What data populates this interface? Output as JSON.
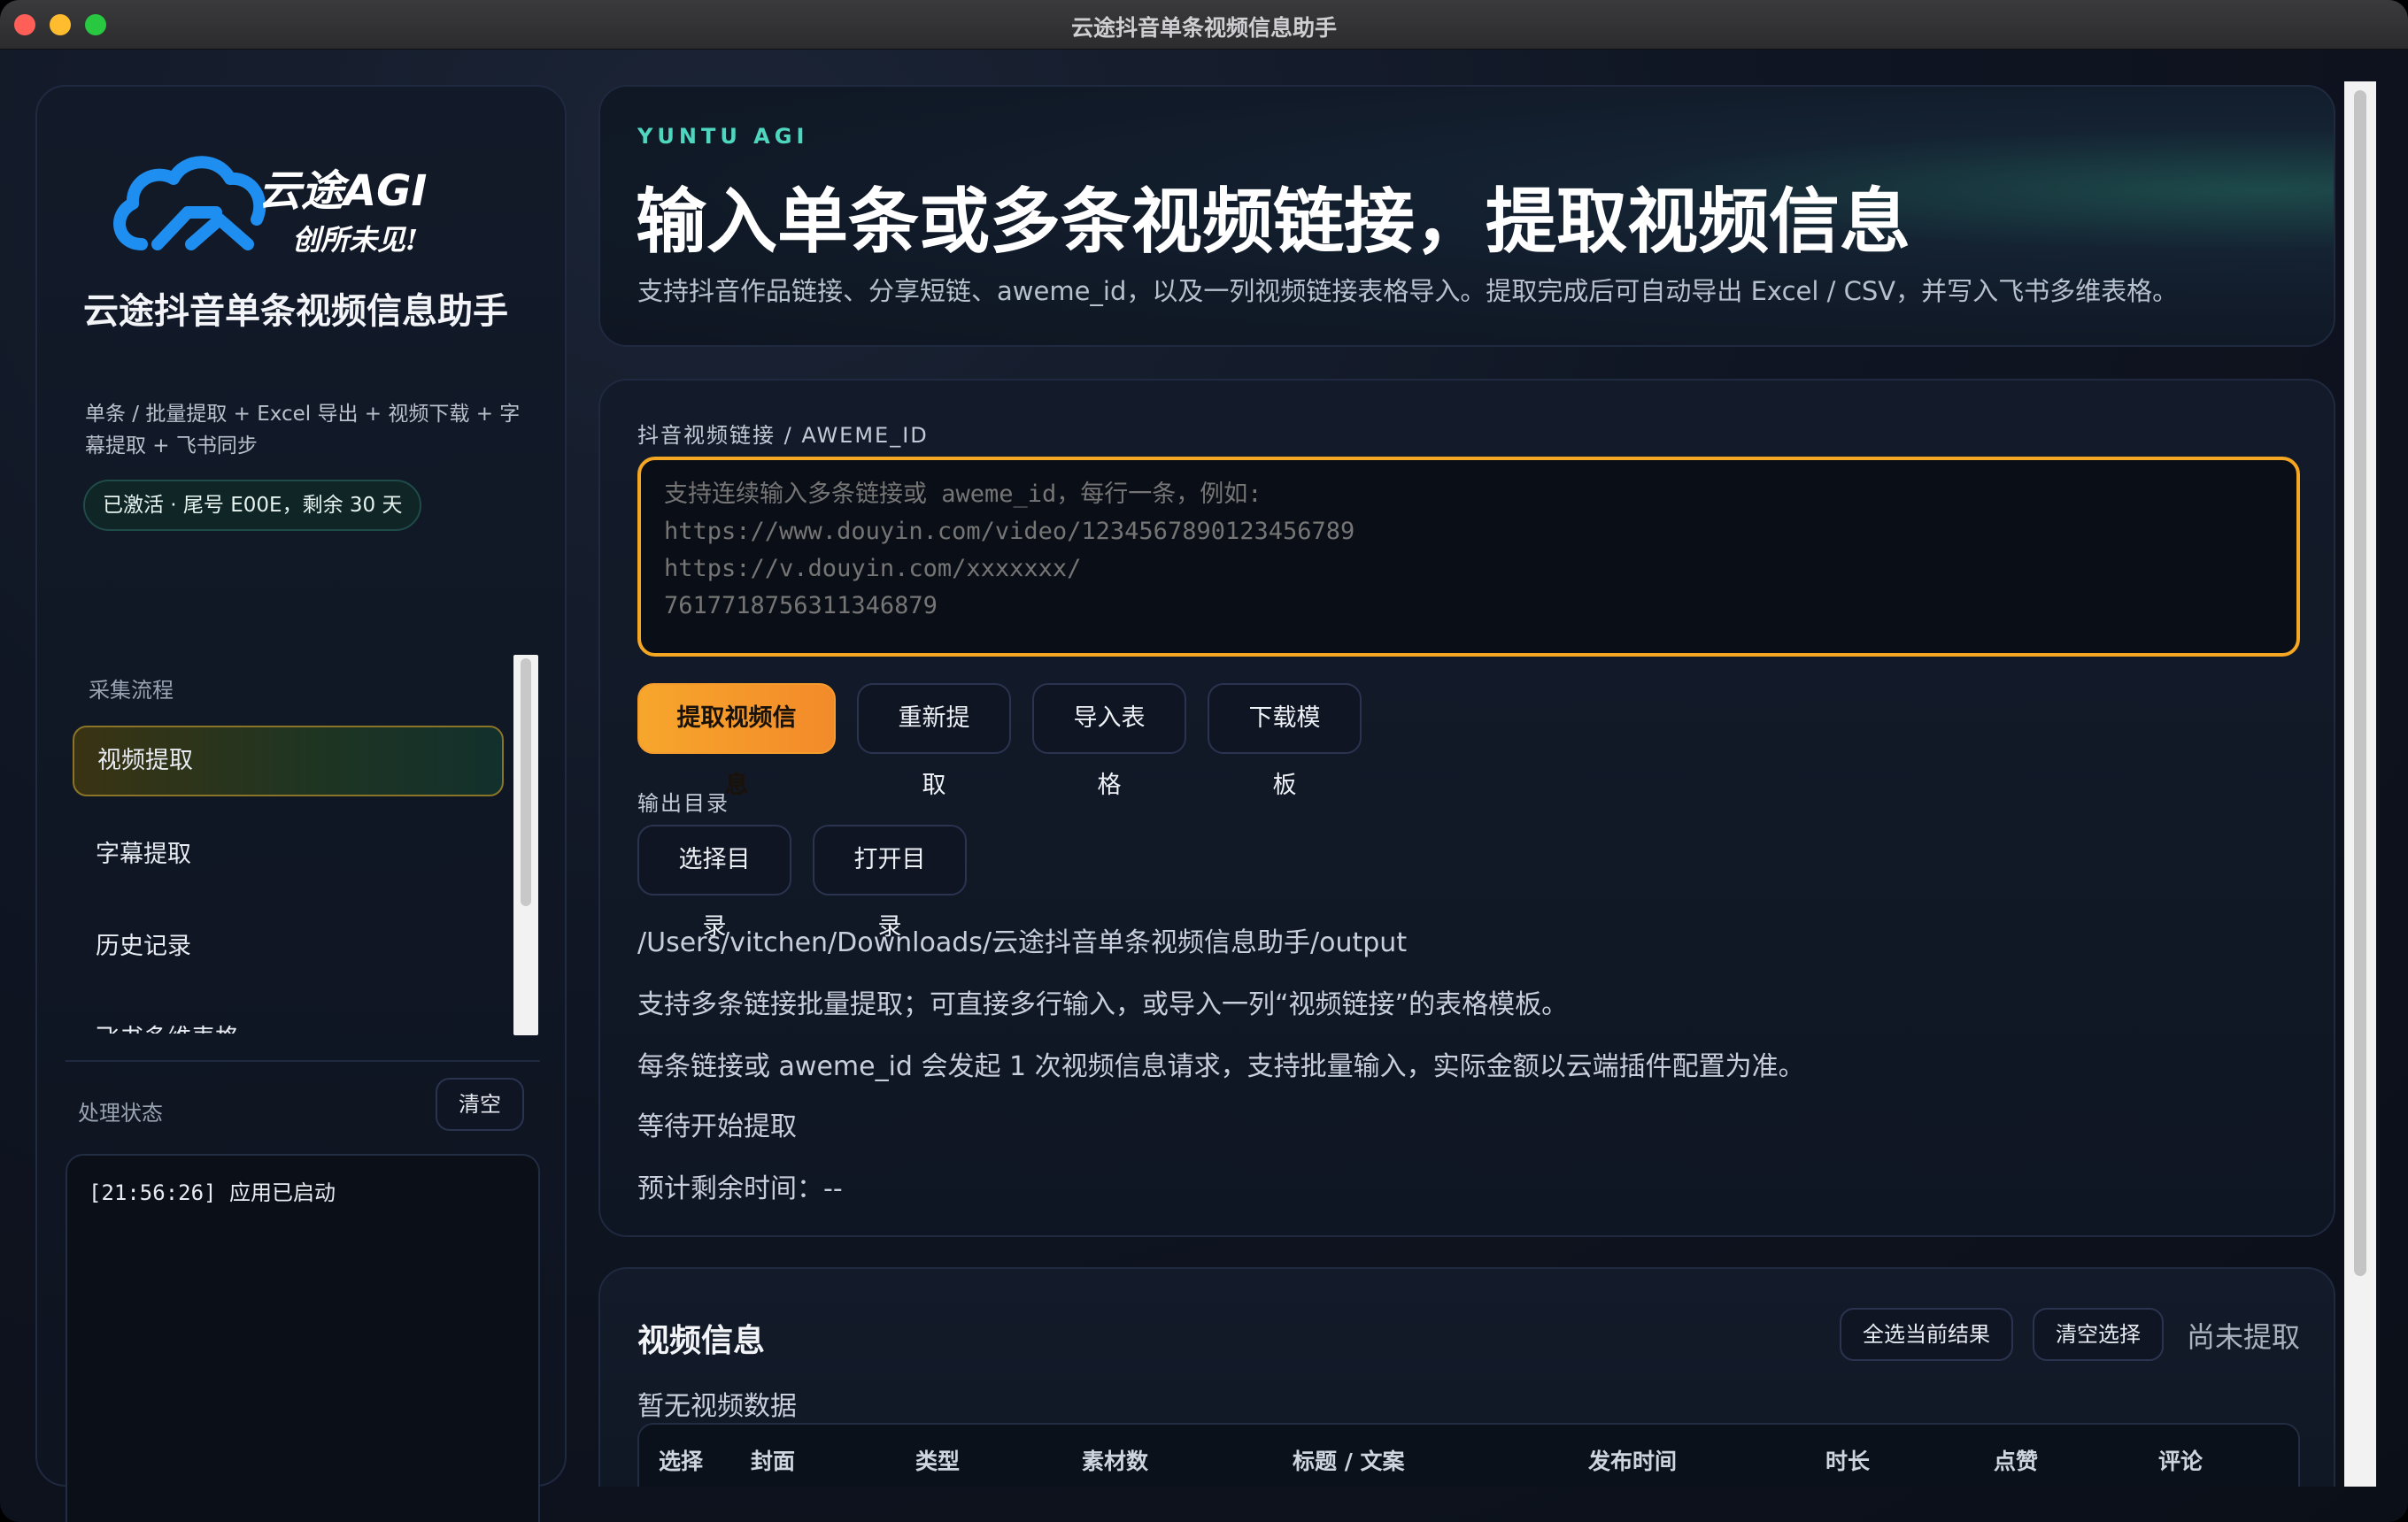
{
  "window": {
    "title": "云途抖音单条视频信息助手"
  },
  "sidebar": {
    "logo": {
      "brand": "云途AGI",
      "slogan": "创所未见!"
    },
    "app_title": "云途抖音单条视频信息助手",
    "app_desc": "单条 / 批量提取 + Excel 导出 + 视频下载 + 字幕提取 + 飞书同步",
    "badge": "已激活 · 尾号 E00E，剩余 30 天",
    "flow_label": "采集流程",
    "nav": [
      {
        "label": "视频提取",
        "active": true
      },
      {
        "label": "字幕提取",
        "active": false
      },
      {
        "label": "历史记录",
        "active": false
      },
      {
        "label": "飞书多维表格",
        "active": false
      }
    ],
    "status_label": "处理状态",
    "clear_label": "清空",
    "log_text": "[21:56:26] 应用已启动"
  },
  "hero": {
    "kicker": "YUNTU AGI",
    "title": "输入单条或多条视频链接，提取视频信息",
    "subtitle": "支持抖音作品链接、分享短链、aweme_id，以及一列视频链接表格导入。提取完成后可自动导出 Excel / CSV，并写入飞书多维表格。"
  },
  "form": {
    "field_label": "抖音视频链接 / AWEME_ID",
    "placeholder": "支持连续输入多条链接或 aweme_id，每行一条，例如:\nhttps://www.douyin.com/video/1234567890123456789\nhttps://v.douyin.com/xxxxxxx/\n7617718756311346879",
    "buttons": {
      "extract": "提取视频信息",
      "re_extract": "重新提取",
      "import": "导入表格",
      "template": "下载模板"
    },
    "output_label": "输出目录",
    "choose_dir": "选择目录",
    "open_dir": "打开目录",
    "output_path": "/Users/vitchen/Downloads/云途抖音单条视频信息助手/output",
    "info": {
      "batch_tip": "支持多条链接批量提取；可直接多行输入，或导入一列“视频链接”的表格模板。",
      "cost_tip": "每条链接或 aweme_id 会发起 1 次视频信息请求，支持批量输入，实际金额以云端插件配置为准。",
      "status": "等待开始提取",
      "eta": "预计剩余时间：--"
    }
  },
  "results": {
    "title": "视频信息",
    "select_all": "全选当前结果",
    "clear_selection": "清空选择",
    "state": "尚未提取",
    "empty": "暂无视频数据",
    "columns": [
      "选择",
      "封面",
      "类型",
      "素材数",
      "标题 / 文案",
      "发布时间",
      "时长",
      "点赞",
      "评论"
    ]
  },
  "colors": {
    "accent": "#f5a623",
    "brand_cyan": "#4ed6bf",
    "logo_blue": "#1e8ff0"
  }
}
